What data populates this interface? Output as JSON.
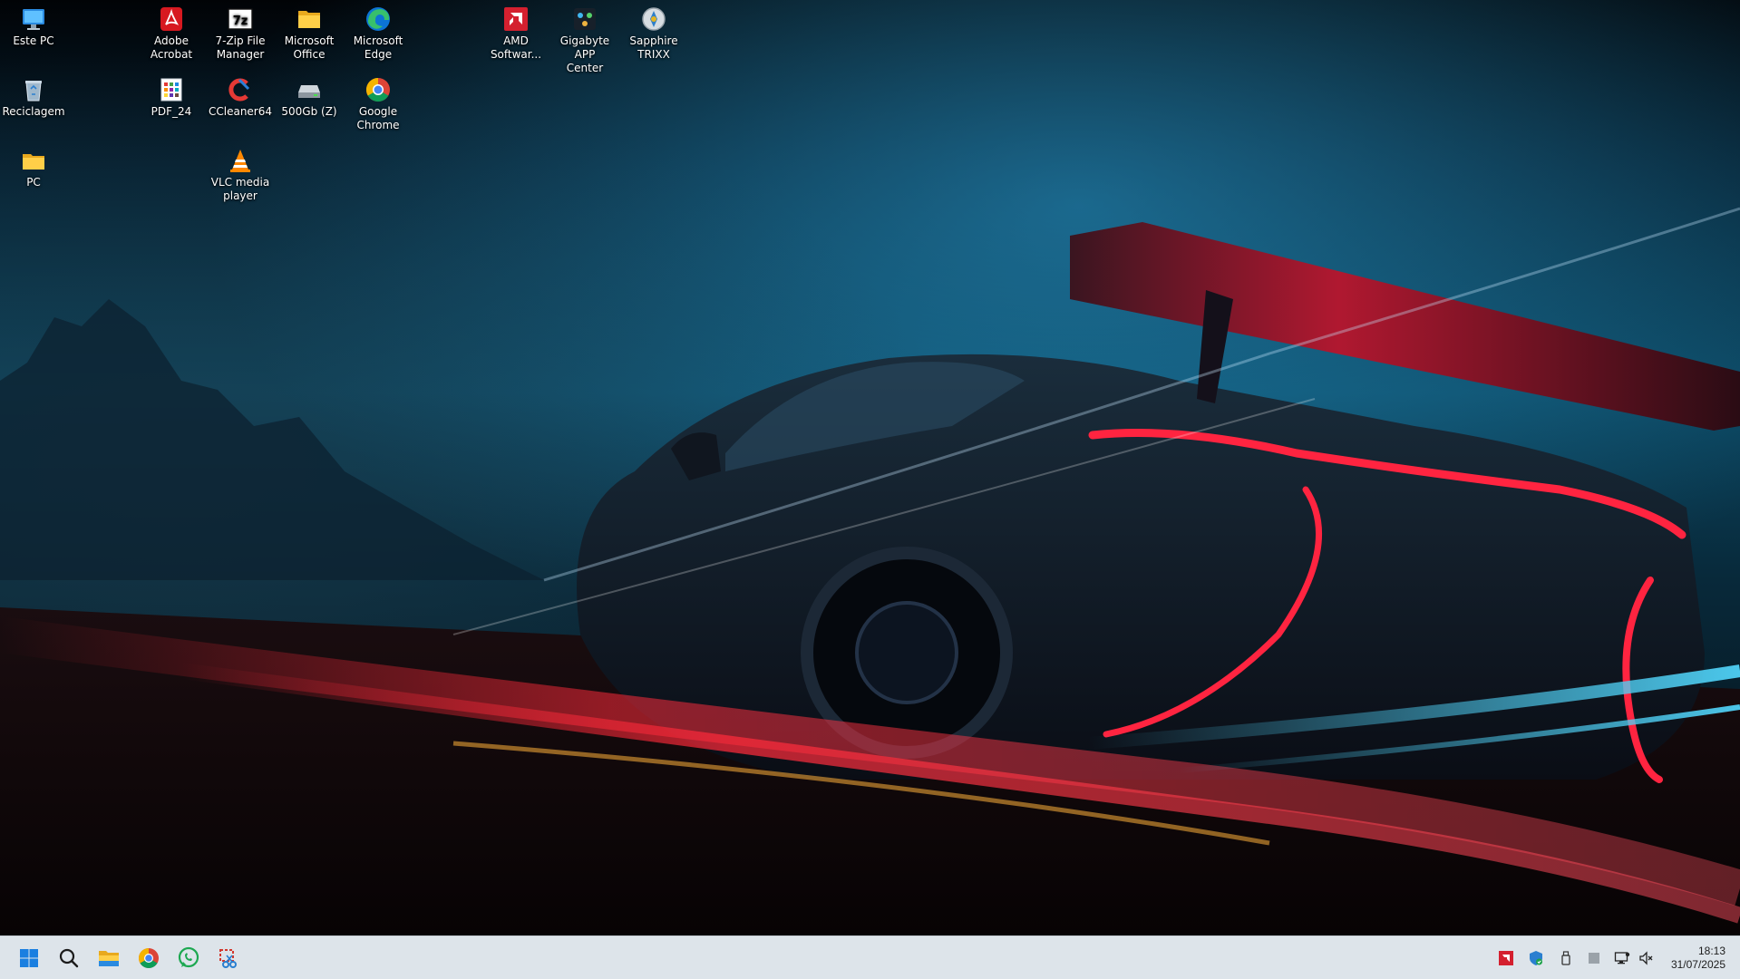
{
  "desktop": {
    "icons": [
      {
        "name": "este-pc",
        "label": "Este PC",
        "icon": "monitor-icon"
      },
      {
        "name": "reciclagem",
        "label": "Reciclagem",
        "icon": "recycle-bin-icon"
      },
      {
        "name": "pc-folder",
        "label": "PC",
        "icon": "folder-icon"
      },
      {
        "name": "adobe-acrobat",
        "label": "Adobe\nAcrobat",
        "icon": "acrobat-icon"
      },
      {
        "name": "pdf24",
        "label": "PDF_24",
        "icon": "pdf24-icon"
      },
      {
        "name": "7zip",
        "label": "7-Zip File\nManager",
        "icon": "7zip-icon"
      },
      {
        "name": "ccleaner",
        "label": "CCleaner64",
        "icon": "ccleaner-icon"
      },
      {
        "name": "vlc",
        "label": "VLC media\nplayer",
        "icon": "vlc-icon"
      },
      {
        "name": "microsoft-office",
        "label": "Microsoft\nOffice",
        "icon": "folder-icon"
      },
      {
        "name": "drive-z",
        "label": "500Gb (Z)",
        "icon": "drive-icon"
      },
      {
        "name": "microsoft-edge",
        "label": "Microsoft\nEdge",
        "icon": "edge-icon"
      },
      {
        "name": "google-chrome",
        "label": "Google\nChrome",
        "icon": "chrome-icon"
      },
      {
        "name": "amd-software",
        "label": "AMD\nSoftwar...",
        "icon": "amd-icon"
      },
      {
        "name": "gigabyte-app-center",
        "label": "Gigabyte APP\nCenter",
        "icon": "gigabyte-icon"
      },
      {
        "name": "sapphire-trixx",
        "label": "Sapphire\nTRIXX",
        "icon": "trixx-icon"
      }
    ]
  },
  "taskbar": {
    "pinned": [
      {
        "name": "start",
        "icon": "windows-start-icon"
      },
      {
        "name": "search",
        "icon": "search-icon"
      },
      {
        "name": "file-explorer",
        "icon": "file-explorer-icon"
      },
      {
        "name": "chrome",
        "icon": "chrome-icon"
      },
      {
        "name": "whatsapp",
        "icon": "whatsapp-icon"
      },
      {
        "name": "snipping-tool",
        "icon": "snipping-tool-icon"
      }
    ],
    "tray": [
      {
        "name": "amd-tray",
        "icon": "amd-icon"
      },
      {
        "name": "security-tray",
        "icon": "windows-security-icon"
      },
      {
        "name": "usb-tray",
        "icon": "usb-icon"
      },
      {
        "name": "generic-tray",
        "icon": "app-icon"
      },
      {
        "name": "network-tray",
        "icon": "network-icon"
      },
      {
        "name": "volume-tray",
        "icon": "volume-muted-icon"
      }
    ],
    "clock": {
      "time": "18:13",
      "date": "31/07/2025"
    }
  },
  "colors": {
    "taskbar": "#dde4ea",
    "windows_blue": "#1a7fe0",
    "accent_red": "#ff2440",
    "accent_cyan": "#47c9f0"
  }
}
